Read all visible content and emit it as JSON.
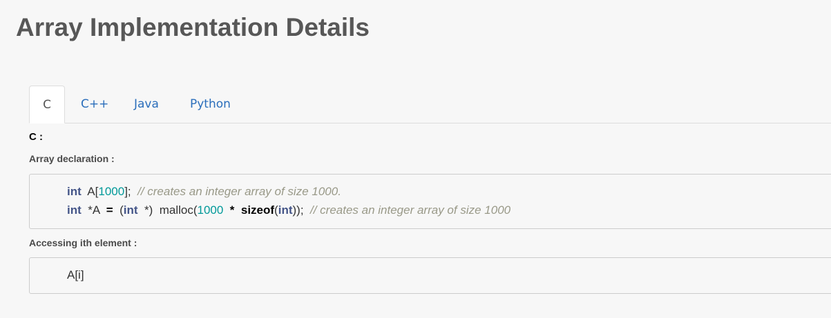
{
  "page": {
    "title": "Array Implementation Details"
  },
  "tabs": [
    {
      "label": "C",
      "active": true
    },
    {
      "label": "C++",
      "active": false
    },
    {
      "label": "Java",
      "active": false
    },
    {
      "label": "Python",
      "active": false
    }
  ],
  "content": {
    "language_heading": "C :",
    "declaration_label": "Array declaration :",
    "declaration_code": {
      "line1": {
        "kw1": "int",
        "t1": "  A[",
        "num1": "1000",
        "t2": "];  ",
        "comment": "// creates an integer array of size 1000."
      },
      "line2": {
        "kw1": "int",
        "t1": "  *A  ",
        "op1": "=",
        "t2": "  (",
        "kw2": "int",
        "t3": "  *)  malloc(",
        "num1": "1000",
        "t4": "  ",
        "op2": "*",
        "t5": "  ",
        "fn1": "sizeof",
        "t6": "(",
        "kw3": "int",
        "t7": "));  ",
        "comment": "// creates an integer array of size 1000"
      }
    },
    "access_label": "Accessing ith element :",
    "access_code": "A[i]"
  },
  "colors": {
    "tab_link": "#2a6ebb",
    "keyword": "#445588",
    "number": "#009999",
    "comment": "#999988",
    "title": "#575757"
  }
}
